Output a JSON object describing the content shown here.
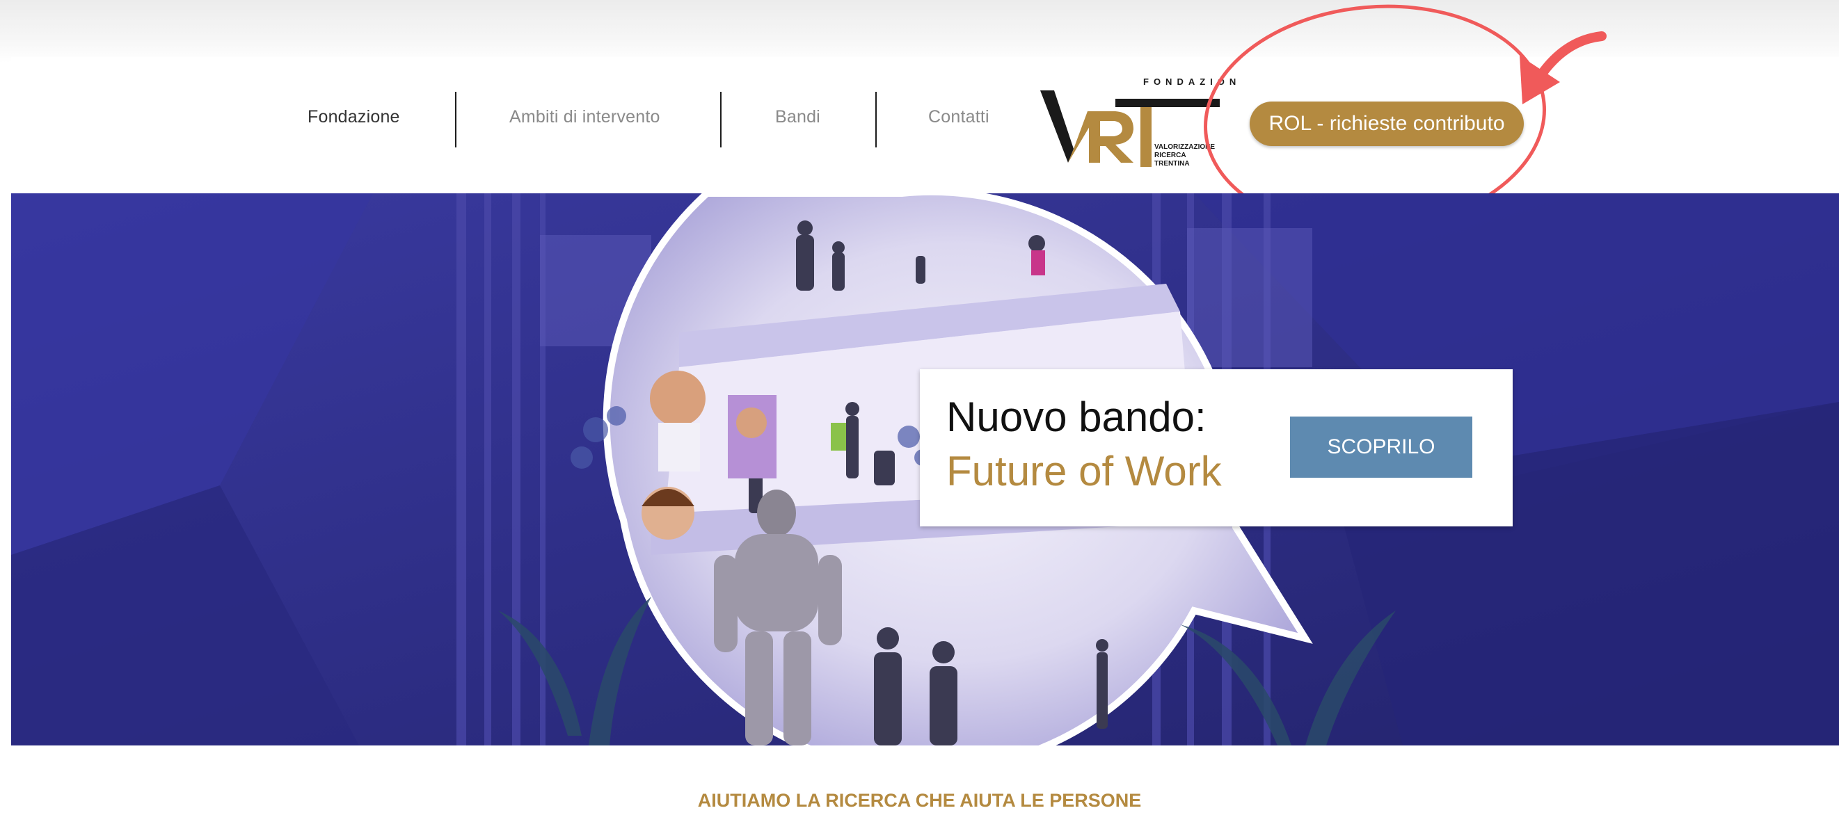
{
  "nav": {
    "items": [
      {
        "label": "Fondazione"
      },
      {
        "label": "Ambiti di intervento"
      },
      {
        "label": "Bandi"
      },
      {
        "label": "Contatti"
      }
    ]
  },
  "logo": {
    "letters": "VRT",
    "top_text": "FONDAZIONE",
    "sub_lines": [
      "VALORIZZAZIONE",
      "RICERCA",
      "TRENTINA"
    ]
  },
  "rol_button": {
    "label": "ROL - richieste contributo"
  },
  "hero": {
    "promo": {
      "line1": "Nuovo bando:",
      "line2": "Future of Work",
      "button_label": "SCOPRILO"
    }
  },
  "tagline": "AIUTIAMO LA RICERCA CHE AIUTA LE PERSONE",
  "colors": {
    "gold": "#b48a40",
    "hero_blue": "#2c2c82",
    "promo_button": "#5e8ab0",
    "annotation_red": "#f05a5a"
  }
}
